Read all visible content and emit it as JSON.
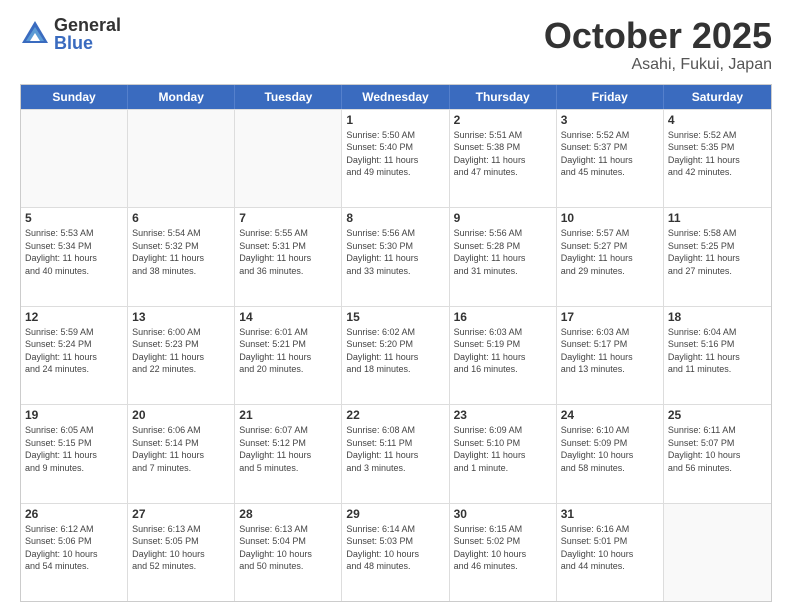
{
  "logo": {
    "general": "General",
    "blue": "Blue"
  },
  "title": {
    "month": "October 2025",
    "location": "Asahi, Fukui, Japan"
  },
  "header_days": [
    "Sunday",
    "Monday",
    "Tuesday",
    "Wednesday",
    "Thursday",
    "Friday",
    "Saturday"
  ],
  "rows": [
    [
      {
        "day": "",
        "info": "",
        "empty": true
      },
      {
        "day": "",
        "info": "",
        "empty": true
      },
      {
        "day": "",
        "info": "",
        "empty": true
      },
      {
        "day": "1",
        "info": "Sunrise: 5:50 AM\nSunset: 5:40 PM\nDaylight: 11 hours\nand 49 minutes."
      },
      {
        "day": "2",
        "info": "Sunrise: 5:51 AM\nSunset: 5:38 PM\nDaylight: 11 hours\nand 47 minutes."
      },
      {
        "day": "3",
        "info": "Sunrise: 5:52 AM\nSunset: 5:37 PM\nDaylight: 11 hours\nand 45 minutes."
      },
      {
        "day": "4",
        "info": "Sunrise: 5:52 AM\nSunset: 5:35 PM\nDaylight: 11 hours\nand 42 minutes."
      }
    ],
    [
      {
        "day": "5",
        "info": "Sunrise: 5:53 AM\nSunset: 5:34 PM\nDaylight: 11 hours\nand 40 minutes."
      },
      {
        "day": "6",
        "info": "Sunrise: 5:54 AM\nSunset: 5:32 PM\nDaylight: 11 hours\nand 38 minutes."
      },
      {
        "day": "7",
        "info": "Sunrise: 5:55 AM\nSunset: 5:31 PM\nDaylight: 11 hours\nand 36 minutes."
      },
      {
        "day": "8",
        "info": "Sunrise: 5:56 AM\nSunset: 5:30 PM\nDaylight: 11 hours\nand 33 minutes."
      },
      {
        "day": "9",
        "info": "Sunrise: 5:56 AM\nSunset: 5:28 PM\nDaylight: 11 hours\nand 31 minutes."
      },
      {
        "day": "10",
        "info": "Sunrise: 5:57 AM\nSunset: 5:27 PM\nDaylight: 11 hours\nand 29 minutes."
      },
      {
        "day": "11",
        "info": "Sunrise: 5:58 AM\nSunset: 5:25 PM\nDaylight: 11 hours\nand 27 minutes."
      }
    ],
    [
      {
        "day": "12",
        "info": "Sunrise: 5:59 AM\nSunset: 5:24 PM\nDaylight: 11 hours\nand 24 minutes."
      },
      {
        "day": "13",
        "info": "Sunrise: 6:00 AM\nSunset: 5:23 PM\nDaylight: 11 hours\nand 22 minutes."
      },
      {
        "day": "14",
        "info": "Sunrise: 6:01 AM\nSunset: 5:21 PM\nDaylight: 11 hours\nand 20 minutes."
      },
      {
        "day": "15",
        "info": "Sunrise: 6:02 AM\nSunset: 5:20 PM\nDaylight: 11 hours\nand 18 minutes."
      },
      {
        "day": "16",
        "info": "Sunrise: 6:03 AM\nSunset: 5:19 PM\nDaylight: 11 hours\nand 16 minutes."
      },
      {
        "day": "17",
        "info": "Sunrise: 6:03 AM\nSunset: 5:17 PM\nDaylight: 11 hours\nand 13 minutes."
      },
      {
        "day": "18",
        "info": "Sunrise: 6:04 AM\nSunset: 5:16 PM\nDaylight: 11 hours\nand 11 minutes."
      }
    ],
    [
      {
        "day": "19",
        "info": "Sunrise: 6:05 AM\nSunset: 5:15 PM\nDaylight: 11 hours\nand 9 minutes."
      },
      {
        "day": "20",
        "info": "Sunrise: 6:06 AM\nSunset: 5:14 PM\nDaylight: 11 hours\nand 7 minutes."
      },
      {
        "day": "21",
        "info": "Sunrise: 6:07 AM\nSunset: 5:12 PM\nDaylight: 11 hours\nand 5 minutes."
      },
      {
        "day": "22",
        "info": "Sunrise: 6:08 AM\nSunset: 5:11 PM\nDaylight: 11 hours\nand 3 minutes."
      },
      {
        "day": "23",
        "info": "Sunrise: 6:09 AM\nSunset: 5:10 PM\nDaylight: 11 hours\nand 1 minute."
      },
      {
        "day": "24",
        "info": "Sunrise: 6:10 AM\nSunset: 5:09 PM\nDaylight: 10 hours\nand 58 minutes."
      },
      {
        "day": "25",
        "info": "Sunrise: 6:11 AM\nSunset: 5:07 PM\nDaylight: 10 hours\nand 56 minutes."
      }
    ],
    [
      {
        "day": "26",
        "info": "Sunrise: 6:12 AM\nSunset: 5:06 PM\nDaylight: 10 hours\nand 54 minutes."
      },
      {
        "day": "27",
        "info": "Sunrise: 6:13 AM\nSunset: 5:05 PM\nDaylight: 10 hours\nand 52 minutes."
      },
      {
        "day": "28",
        "info": "Sunrise: 6:13 AM\nSunset: 5:04 PM\nDaylight: 10 hours\nand 50 minutes."
      },
      {
        "day": "29",
        "info": "Sunrise: 6:14 AM\nSunset: 5:03 PM\nDaylight: 10 hours\nand 48 minutes."
      },
      {
        "day": "30",
        "info": "Sunrise: 6:15 AM\nSunset: 5:02 PM\nDaylight: 10 hours\nand 46 minutes."
      },
      {
        "day": "31",
        "info": "Sunrise: 6:16 AM\nSunset: 5:01 PM\nDaylight: 10 hours\nand 44 minutes."
      },
      {
        "day": "",
        "info": "",
        "empty": true
      }
    ]
  ]
}
